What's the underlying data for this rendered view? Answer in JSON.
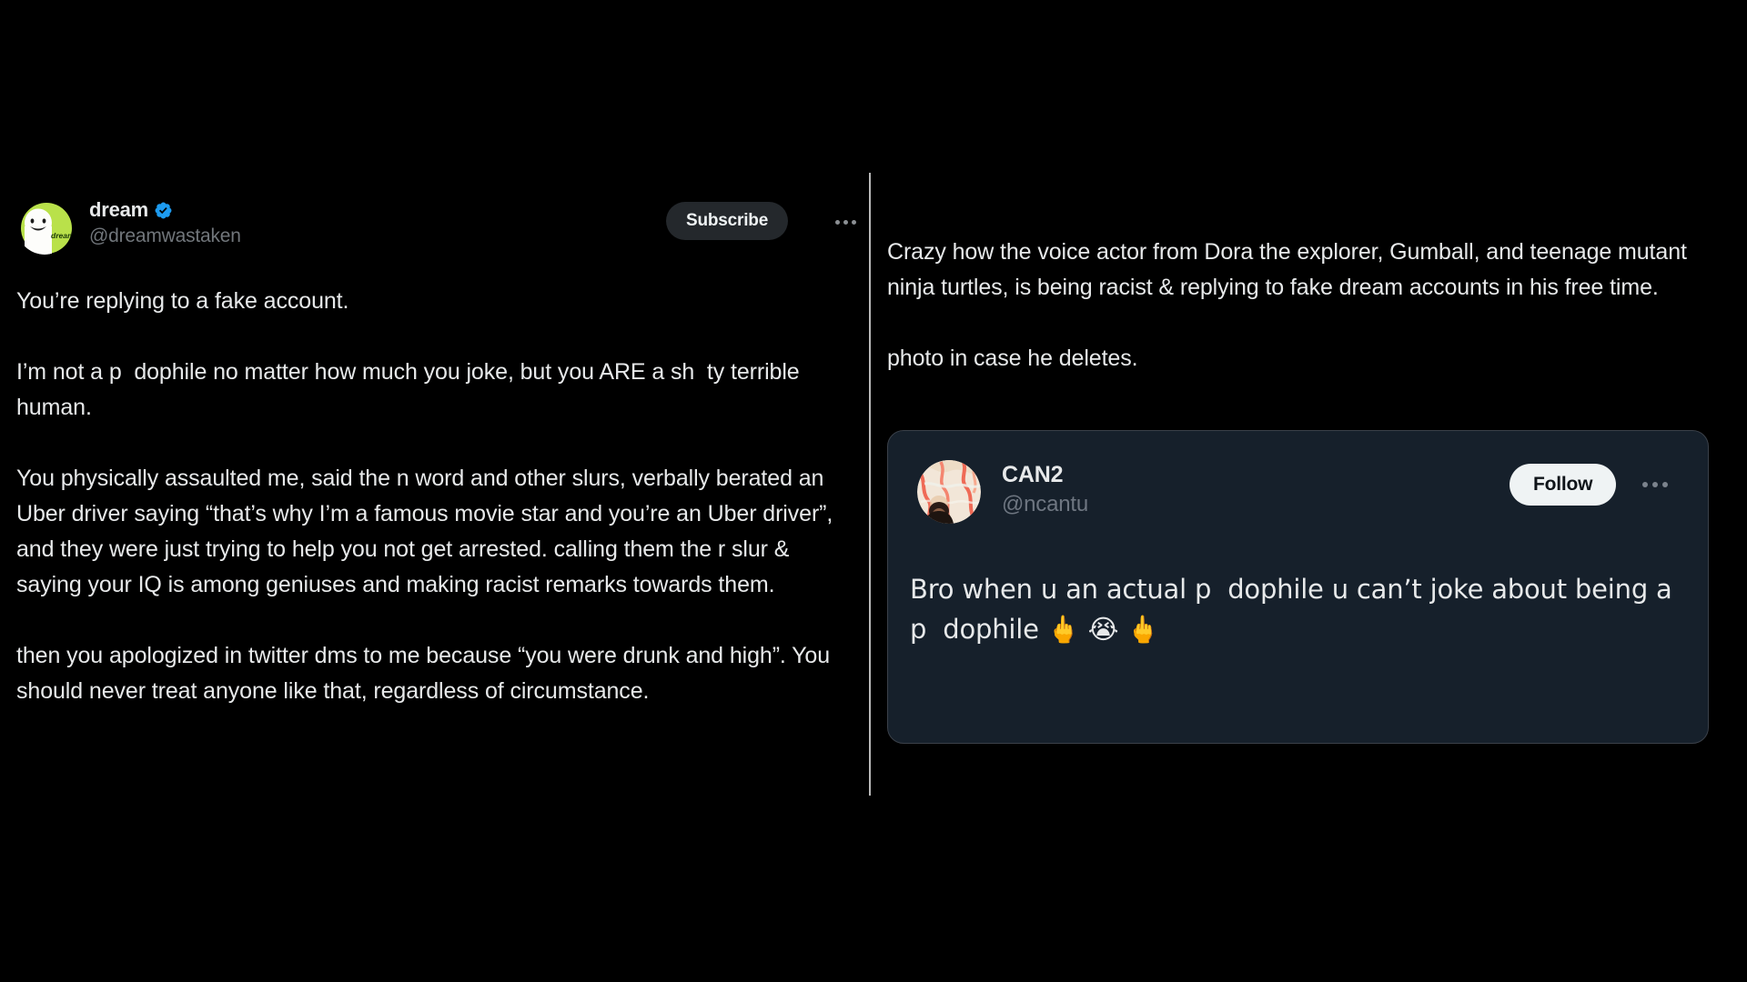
{
  "theme": {
    "page_background": "#000000",
    "text_primary": "#e7e9ea",
    "text_muted": "#71767b",
    "verified_blue": "#1d9bf0",
    "subscribe_button_bg": "#24282c",
    "follow_button_bg": "#eff3f4",
    "follow_button_text": "#0f1419",
    "quote_card_bg": "#16202b",
    "quote_card_border": "#3a4049",
    "divider_color": "#b8b8b8",
    "dream_avatar_green": "#b9e14a"
  },
  "left_tweet": {
    "display_name": "dream",
    "verified_icon": "verified-badge-icon",
    "handle": "@dreamwastaken",
    "subscribe_label": "Subscribe",
    "more_icon": "more-horizontal-icon",
    "avatar_icon": "dream-avatar",
    "avatar_caption": "dream",
    "body": "You’re replying to a fake account.\n\nI’m not a p  dophile no matter how much you joke, but you ARE a sh  ty terrible human.\n\nYou physically assaulted me, said the n word and other slurs, verbally berated an Uber driver saying “that’s why I’m a famous movie star and you’re an Uber driver”, and they were just trying to help you not get arrested. calling them the r slur & saying your IQ is among geniuses and making racist remarks towards them.\n\nthen you apologized in twitter dms to me because “you were drunk and high”. You should never treat anyone like that, regardless of circumstance."
  },
  "right_tweet": {
    "body": "Crazy how the voice actor from Dora the explorer, Gumball, and teenage mutant ninja turtles, is being racist & replying to fake dream accounts in his free time.\n\nphoto in case he deletes.",
    "quoted": {
      "display_name": "CAN2",
      "handle": "@ncantu",
      "follow_label": "Follow",
      "more_icon": "more-horizontal-icon",
      "avatar_icon": "can2-avatar",
      "body": "Bro when u an actual p  dophile u can’t joke about being a p  dophile 🖕 😭 🖕"
    }
  }
}
